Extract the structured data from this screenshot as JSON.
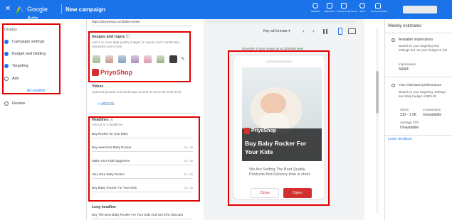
{
  "topbar": {
    "close_label": "✕",
    "app_name": "Google Ads",
    "campaign_title": "New campaign",
    "tools": [
      {
        "label": "SEARCH"
      },
      {
        "label": "REPORTS"
      },
      {
        "label": "TOOLS & SETTINGS"
      },
      {
        "label": "HELP"
      },
      {
        "label": "NOTIFICATIONS"
      }
    ]
  },
  "nav": {
    "items": [
      {
        "label": "Display",
        "state": "muted"
      },
      {
        "label": "Campaign settings",
        "state": "done"
      },
      {
        "label": "Budget and bidding",
        "state": "done"
      },
      {
        "label": "Targeting",
        "state": "done"
      },
      {
        "label": "Ads",
        "state": "current"
      },
      {
        "label": "Ad creation",
        "state": "sub"
      },
      {
        "label": "Review",
        "state": "todo"
      }
    ]
  },
  "editor": {
    "final_url": "https://priyoshop.com/baby-rocker",
    "images": {
      "heading": "Images and logos",
      "help": "Add 1 or more high-quality images (1 square and 1 landscape required) Learn more",
      "logo_text": "PriyoShop"
    },
    "videos": {
      "heading": "Videos",
      "help": "Optional (portrait and landscape around 30 seconds work best)",
      "add_label": "+ VIDEOS"
    },
    "headlines": {
      "heading": "Headlines",
      "help": "Add up to 5 headlines",
      "items": [
        {
          "text": "Buy Rocker for your baby",
          "count": ""
        },
        {
          "text": "Buy Awesome Baby Rocker",
          "count": "24 / 30"
        },
        {
          "text": "Make Your Kids happiness",
          "count": "24 / 30"
        },
        {
          "text": "Very Nice Baby Rocker",
          "count": "21 / 30"
        },
        {
          "text": "Buy Baby Rocker For Your Kids",
          "count": "29 / 30"
        }
      ]
    },
    "long_headline": {
      "heading": "Long headline",
      "value": "Buy The Best Baby Rocker For Your Kids And Get 20% discount"
    }
  },
  "preview": {
    "format_select": "Key ad formats ▾",
    "caption": "Example of your image ad at 320x269",
    "new_badge": "New",
    "ad_brand": "PriyoShop",
    "ad_headline": "Buy Baby Rocker For Your Kids",
    "ad_description": "We Are Setting The Best Quality Products And Delivery time is short",
    "close_button": "Close",
    "open_button": "Open"
  },
  "estimates": {
    "title": "Weekly estimates",
    "available_label": "Available impressions",
    "available_desc": "Based on your targeting and settings but not your budget or bid",
    "impressions_label": "Impressions",
    "impressions_value": "580M",
    "perf_label": "Your estimated performance",
    "perf_desc": "Based on your targeting, settings and daily budget of $29.00",
    "clicks_label": "Clicks",
    "clicks_value": "210 - 1.5K",
    "conversions_label": "Conversions",
    "conversions_value": "Unavailable",
    "cpc_label": "Average CPC",
    "cpc_value": "Unavailable",
    "feedback": "Leave feedback"
  },
  "colors": {
    "brand_blue": "#1a73e8",
    "annotation_red": "#e00000",
    "open_red": "#d32f2f"
  }
}
